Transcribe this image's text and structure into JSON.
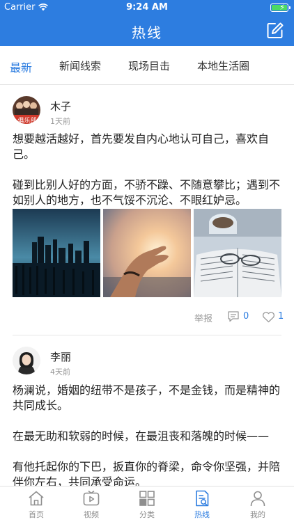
{
  "status_bar": {
    "carrier": "Carrier",
    "time": "9:24 AM"
  },
  "nav": {
    "title": "热线",
    "edit_icon": "edit-icon"
  },
  "tabs": [
    {
      "label": "最新",
      "active": true
    },
    {
      "label": "新闻线索",
      "active": false
    },
    {
      "label": "现场目击",
      "active": false
    },
    {
      "label": "本地生活圈",
      "active": false
    }
  ],
  "posts": [
    {
      "author": "木子",
      "time_ago": "1天前",
      "content": "想要越活越好，首先要发自内心地认可自己，喜欢自己。\n\n碰到比别人好的方面，不骄不躁、不随意攀比；遇到不如别人的地方，也不气馁不沉沦、不眼红妒忌。",
      "avatar_text": "俱乐部",
      "photos": [
        "city-skyline-photo",
        "hand-sunset-photo",
        "book-glasses-photo"
      ],
      "report_label": "举报",
      "comment_count": "0",
      "like_count": "1"
    },
    {
      "author": "李丽",
      "time_ago": "4天前",
      "content": "杨澜说，婚姻的纽带不是孩子，不是金钱，而是精神的共同成长。\n\n在最无助和软弱的时候，在最沮丧和落魄的时候——\n\n有他托起你的下巴，扳直你的脊梁，命令你坚强，并陪伴你左右，共同承受命运。"
    }
  ],
  "tabbar": [
    {
      "label": "首页",
      "icon": "home-icon",
      "active": false
    },
    {
      "label": "视频",
      "icon": "video-icon",
      "active": false
    },
    {
      "label": "分类",
      "icon": "category-icon",
      "active": false
    },
    {
      "label": "热线",
      "icon": "hotline-icon",
      "active": true
    },
    {
      "label": "我的",
      "icon": "profile-icon",
      "active": false
    }
  ],
  "colors": {
    "brand": "#2d7de0",
    "text": "#222222",
    "muted": "#999999",
    "battery": "#4cd964"
  }
}
